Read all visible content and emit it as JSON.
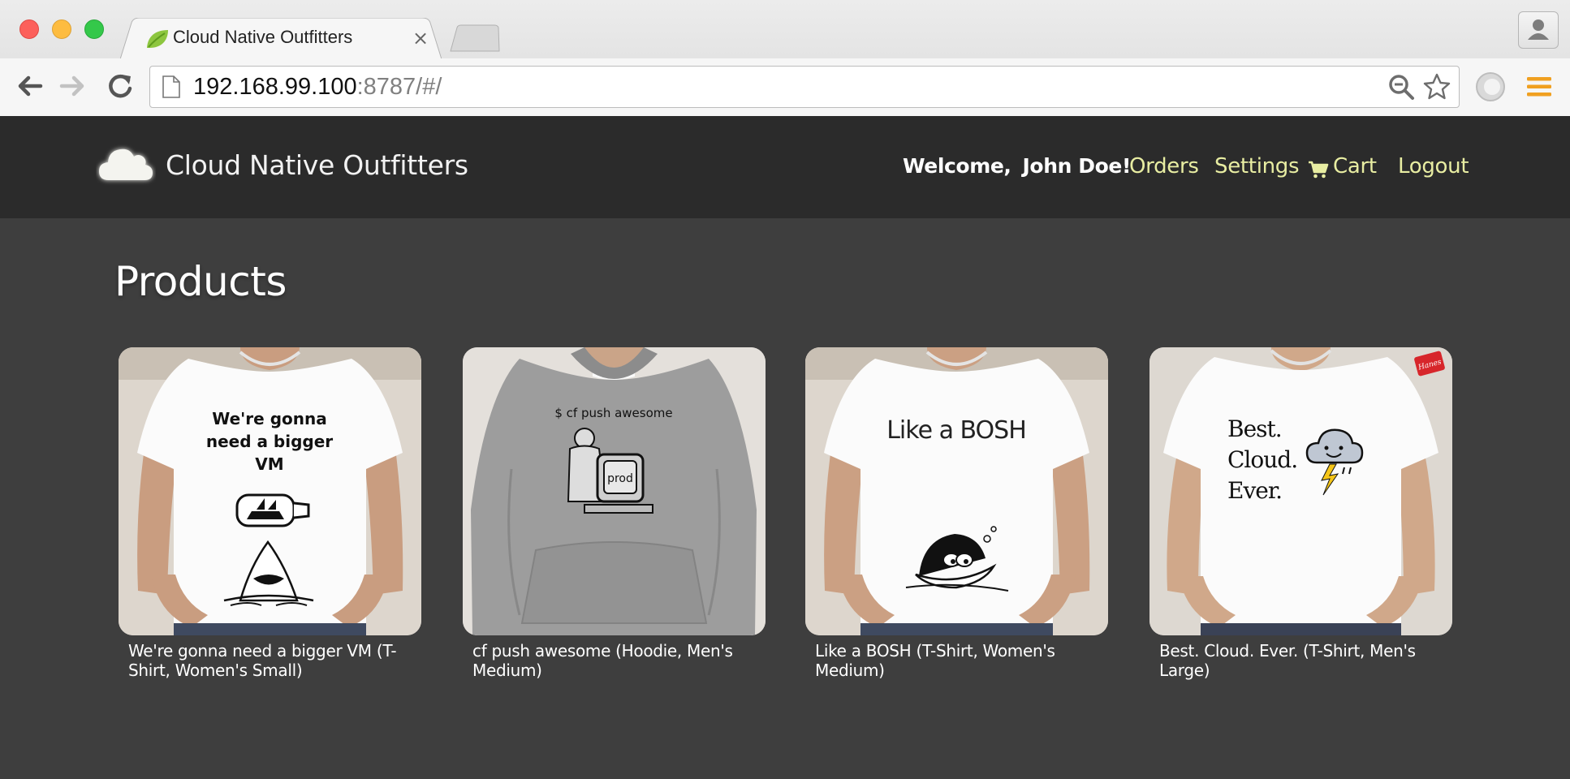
{
  "browser": {
    "tab_title": "Cloud Native Outfitters",
    "tab_close": "×",
    "url_host": "192.168.99.100",
    "url_rest": ":8787/#/"
  },
  "header": {
    "brand": "Cloud Native Outfitters",
    "welcome_label": "Welcome,",
    "user_name": "John Doe!",
    "nav": {
      "orders": "Orders",
      "settings": "Settings",
      "cart": "Cart",
      "logout": "Logout"
    },
    "link_color": "#e8eda2"
  },
  "main": {
    "title": "Products",
    "products": [
      {
        "name": "We're gonna need a bigger VM (T-Shirt, Women's Small)",
        "print_lines": [
          "We're gonna",
          "need a bigger",
          "VM"
        ],
        "garment_color": "#ffffff"
      },
      {
        "name": "cf push awesome (Hoodie, Men's Medium)",
        "print_lines": [
          "$ cf push awesome",
          "prod"
        ],
        "garment_color": "#9e9e9e"
      },
      {
        "name": "Like a BOSH (T-Shirt, Women's Medium)",
        "print_lines": [
          "Like a BOSH"
        ],
        "garment_color": "#ffffff"
      },
      {
        "name": "Best. Cloud. Ever. (T-Shirt, Men's Large)",
        "print_lines": [
          "Best.",
          "Cloud.",
          "Ever.",
          "Hanes"
        ],
        "garment_color": "#ffffff"
      }
    ]
  }
}
